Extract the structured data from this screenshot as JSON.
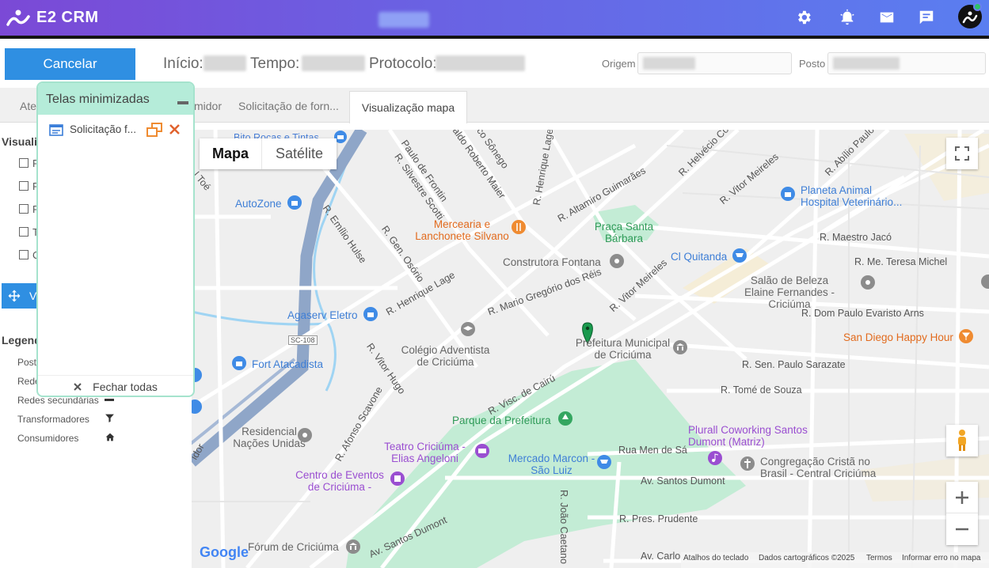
{
  "app": {
    "title": "E2 CRM"
  },
  "header": {
    "cancel_label": "Cancelar",
    "inicio_label": "Início:",
    "tempo_label": "Tempo:",
    "protocolo_label": "Protocolo:",
    "origem_label": "Origem",
    "posto_label": "Posto"
  },
  "tabs": [
    {
      "label": "Ate"
    },
    {
      "label": "midor"
    },
    {
      "label": "Solicitação de forn..."
    },
    {
      "label": "Visualização mapa"
    }
  ],
  "left_panel": {
    "section_title": "Visualiz",
    "checkbox_letters": [
      "P",
      "R",
      "R",
      "T",
      "C"
    ],
    "move_button_letter": "V",
    "legend_title": "Legend",
    "legend_items": [
      "Poste",
      "Rede",
      "Redes secundárias",
      "Transformadores",
      "Consumidores"
    ]
  },
  "minimized_window": {
    "title": "Telas minimizadas",
    "item_label": "Solicitação f...",
    "close_all_label": "Fechar todas"
  },
  "map": {
    "type_buttons": [
      "Mapa",
      "Satélite"
    ],
    "streets": [
      "Bito Roças e Tintas",
      "Paulo de Frontin",
      "R. Silvestre Scotti",
      "svaldo Roberto Maier",
      "ico Sônego",
      "R. Henrique Lage",
      "R. Altamiro Guimarães",
      "R. Helvécio Co",
      "R. Vitor Meireles",
      "R. Abílio Paulo",
      "R. Emílio Hulse",
      "R. Gen. Osório",
      "R. Maestro Jacó",
      "R. Me. Teresa Michel",
      "R. Mario Gregório dos Réis",
      "R. Henrique Lage",
      "R. Vitor Meireles",
      "R. Dom Paulo Evaristo Arns",
      "R. Vitor Hugo",
      "R. Sen. Paulo Sarazate",
      "R. Visc. de Cairú",
      "R. Tomé de Souza",
      "R. Afonso Scavone",
      "Rua Men de Sá",
      "Av. Santos Dumont",
      "R. Pres. Prudente",
      "Av. Santos Dumont",
      "R. João Caetano",
      "Av. Carlo",
      "l Toé",
      "idor",
      "SC-108"
    ],
    "pois": [
      {
        "name": "AutoZone"
      },
      {
        "name": "Mercearia e Lanchonete Silvano"
      },
      {
        "name": "Praça Santa Bárbara"
      },
      {
        "name": "Planeta Animal Hospital Veterinário..."
      },
      {
        "name": "Construtora Fontana"
      },
      {
        "name": "Cl Quitanda"
      },
      {
        "name": "Salão de Beleza Elaine Fernandes - Criciúma"
      },
      {
        "name": "Agaserv Eletro"
      },
      {
        "name": "Colégio Adventista de Criciúma"
      },
      {
        "name": "Prefeitura Municipal de Criciúma"
      },
      {
        "name": "San Diego Happy Hour"
      },
      {
        "name": "Fort Atacadista"
      },
      {
        "name": "Parque da Prefeitura"
      },
      {
        "name": "Plurall Coworking Santos Dumont (Matriz)"
      },
      {
        "name": "Residencial Nações Unidas"
      },
      {
        "name": "Teatro Criciúma - Elias Angeloni"
      },
      {
        "name": "Mercado Marcon - São Luiz"
      },
      {
        "name": "Congregação Cristã no Brasil - Central Criciúma"
      },
      {
        "name": "Centro de Eventos de Criciúma - José..."
      },
      {
        "name": "Fórum de Criciúma"
      }
    ],
    "attribution": {
      "google": "Google",
      "shortcuts": "Atalhos do teclado",
      "data": "Dados cartográficos ©2025",
      "terms": "Termos",
      "report": "Informar erro no mapa"
    }
  },
  "colors": {
    "cancel": "#2f8fe2",
    "minimized_header": "#b5ecd9",
    "park": "#c3ecd5",
    "highway": "#8fa6c8"
  }
}
